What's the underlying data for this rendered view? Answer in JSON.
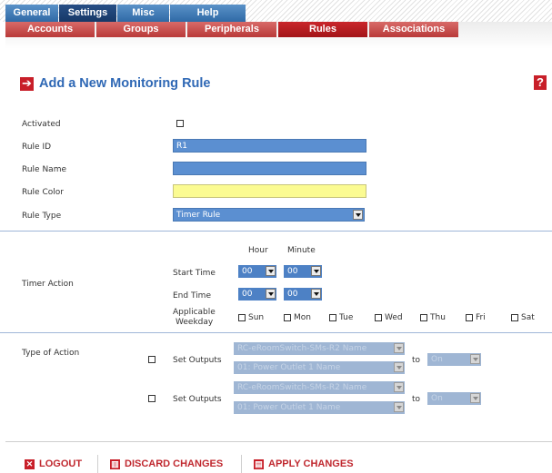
{
  "top_tabs": [
    {
      "label": "General",
      "active": false
    },
    {
      "label": "Settings",
      "active": true
    },
    {
      "label": "Misc",
      "active": false
    },
    {
      "label": "Help",
      "active": false
    }
  ],
  "sub_tabs": [
    {
      "label": "Accounts",
      "active": false
    },
    {
      "label": "Groups",
      "active": false
    },
    {
      "label": "Peripherals",
      "active": false
    },
    {
      "label": "Rules",
      "active": true
    },
    {
      "label": "Associations",
      "active": false
    }
  ],
  "header": {
    "title": "Add a New Monitoring Rule",
    "help": "?"
  },
  "form": {
    "activated_label": "Activated",
    "activated_checked": false,
    "rule_id_label": "Rule ID",
    "rule_id_value": "R1",
    "rule_name_label": "Rule Name",
    "rule_name_value": "",
    "rule_color_label": "Rule Color",
    "rule_color_value": "#fbfb92",
    "rule_type_label": "Rule Type",
    "rule_type_value": "Timer Rule"
  },
  "timer": {
    "section_label": "Timer Action",
    "hour_header": "Hour",
    "minute_header": "Minute",
    "start_label": "Start Time",
    "end_label": "End Time",
    "start_hour": "00",
    "start_minute": "00",
    "end_hour": "00",
    "end_minute": "00",
    "weekday_label_line1": "Applicable",
    "weekday_label_line2": "Weekday",
    "days": [
      "Sun",
      "Mon",
      "Tue",
      "Wed",
      "Thu",
      "Fri",
      "Sat"
    ]
  },
  "actions": {
    "section_label": "Type of Action",
    "set_outputs_label": "Set Outputs",
    "to_label": "to",
    "rows": [
      {
        "device": "RC-eRoomSwitch-SMs-R2 Name",
        "outlet": "01: Power Outlet 1 Name",
        "state": "On"
      },
      {
        "device": "RC-eRoomSwitch-SMs-R2 Name",
        "outlet": "01: Power Outlet 1 Name",
        "state": "On"
      }
    ]
  },
  "footer": {
    "logout": "LOGOUT",
    "discard": "DISCARD CHANGES",
    "apply": "APPLY CHANGES"
  },
  "colors": {
    "accent_blue": "#2f68b5",
    "accent_red": "#c81f29",
    "field_blue": "#5b8fd1"
  }
}
